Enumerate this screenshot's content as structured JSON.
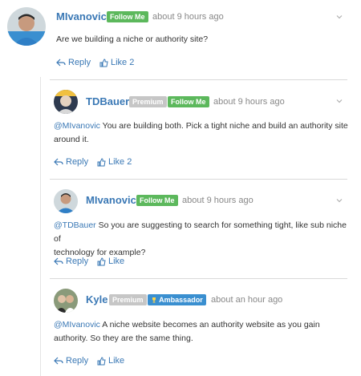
{
  "comments": [
    {
      "user": "MIvanovic",
      "badges": [
        "Follow Me"
      ],
      "time": "about 9 hours ago",
      "mention": "",
      "text": "Are we building a niche or authority site?",
      "text_line2": "",
      "reply": "Reply",
      "like": "Like 2"
    },
    {
      "user": "TDBauer",
      "badges": [
        "Premium",
        "Follow Me"
      ],
      "time": "about 9 hours ago",
      "mention": "@MIvanovic",
      "text": " You are building both. Pick a tight niche and build an authority site",
      "text_line2": "around it.",
      "reply": "Reply",
      "like": "Like 2"
    },
    {
      "user": "MIvanovic",
      "badges": [
        "Follow Me"
      ],
      "time": "about 9 hours ago",
      "mention": "@TDBauer",
      "text": " So you are suggesting to search for something tight, like sub niche of",
      "text_line2": "technology for example?",
      "reply": "Reply",
      "like": "Like"
    },
    {
      "user": "Kyle",
      "badges": [
        "Premium",
        "Ambassador"
      ],
      "time": "about an hour ago",
      "mention": "@MIvanovic",
      "text": " A niche website becomes an authority website as you gain",
      "text_line2": "authority. So they are the same thing.",
      "reply": "Reply",
      "like": "Like"
    }
  ],
  "colors": {
    "link": "#3a78b5",
    "follow_badge": "#5cb85c",
    "premium_badge": "#c6c6c6",
    "ambassador_badge": "#3a8fd0"
  },
  "icons": {
    "reply": "reply-arrow-icon",
    "like": "thumbs-up-icon",
    "menu": "chevron-down-icon",
    "ambassador": "trophy-icon"
  }
}
